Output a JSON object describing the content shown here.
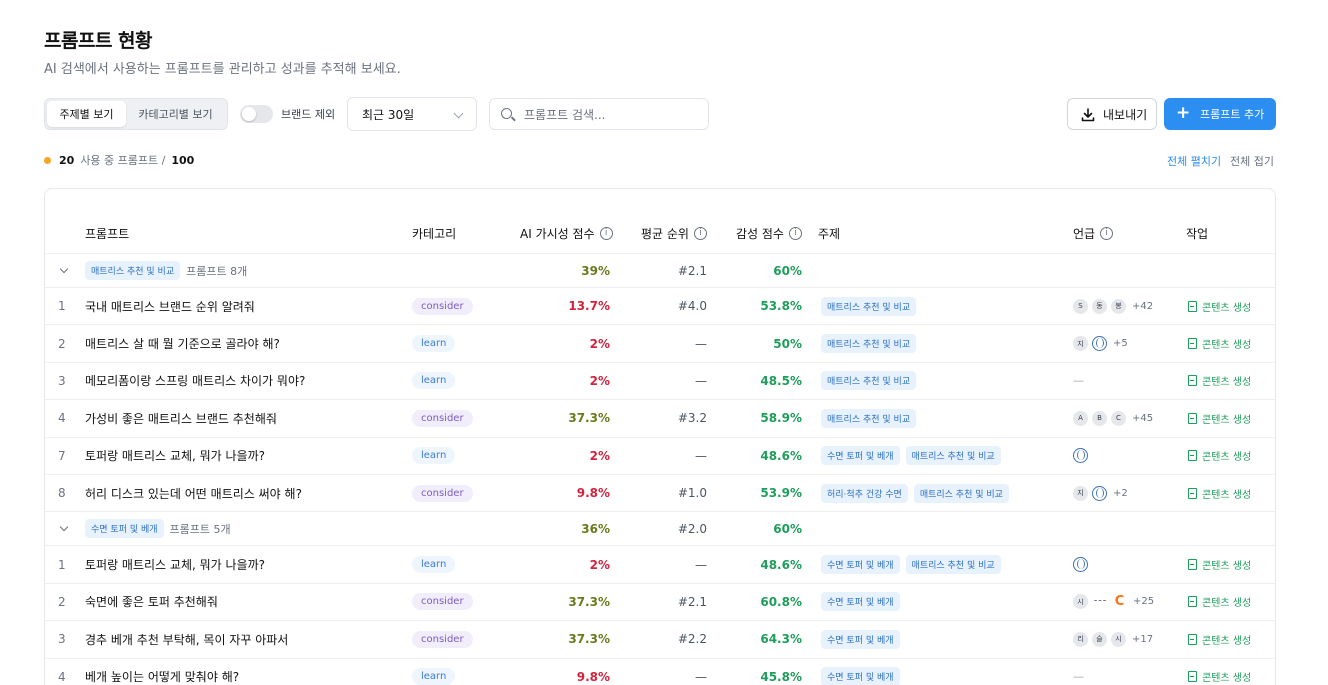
{
  "page": {
    "title": "프롬프트 현황",
    "subtitle": "AI 검색에서 사용하는 프롬프트를 관리하고 성과를 추적해 보세요."
  },
  "toolbar": {
    "view_topic": "주제별 보기",
    "view_category": "카테고리별 보기",
    "brand_toggle_label": "브랜드 제외",
    "period_value": "최근 30일",
    "search_placeholder": "프롬프트 검색...",
    "export_label": "내보내기",
    "add_label": "프롬프트 추가"
  },
  "usage": {
    "used": "20",
    "label": "사용 중 프롬프트 /",
    "total": "100",
    "expand_all": "전체 펼치기",
    "collapse_all": "전체 접기"
  },
  "colors": {
    "accent": "#2b8ef0",
    "score_red": "#d3243d",
    "score_olive": "#6b7a1f",
    "score_green": "#1f9d5b"
  },
  "table": {
    "headers": {
      "prompt": "프롬프트",
      "category": "카테고리",
      "visibility": "AI 가시성 점수",
      "rank": "평균 순위",
      "sentiment": "감성 점수",
      "topic": "주제",
      "mentions": "언급",
      "action": "작업"
    },
    "info_icon": "i",
    "action_label": "콘텐츠 생성",
    "groups": [
      {
        "tag": "매트리스 추천 및 비교",
        "count": "프롬프트 8개",
        "visibility": "39%",
        "rank": "#2.1",
        "sentiment": "60%",
        "visibility_color": "olive",
        "rows": [
          {
            "idx": "1",
            "prompt": "국내 매트리스 브랜드 순위 알려줘",
            "category": "consider",
            "visibility": "13.7%",
            "vcolor": "red",
            "rank": "#4.0",
            "sentiment": "53.8%",
            "topics": [
              "매트리스 추천 및 비교"
            ],
            "mentions": [
              {
                "t": "S"
              },
              {
                "t": "동"
              },
              {
                "t": "봉"
              }
            ],
            "more": "+42"
          },
          {
            "idx": "2",
            "prompt": "매트리스 살 때 뭘 기준으로 골라야 해?",
            "category": "learn",
            "visibility": "2%",
            "vcolor": "red",
            "rank": "—",
            "sentiment": "50%",
            "topics": [
              "매트리스 추천 및 비교"
            ],
            "mentions": [
              {
                "t": "지"
              },
              {
                "t": "globe"
              }
            ],
            "more": "+5"
          },
          {
            "idx": "3",
            "prompt": "메모리폼이랑 스프링 매트리스 차이가 뭐야?",
            "category": "learn",
            "visibility": "2%",
            "vcolor": "red",
            "rank": "—",
            "sentiment": "48.5%",
            "topics": [
              "매트리스 추천 및 비교"
            ],
            "mentions": [],
            "more": "—"
          },
          {
            "idx": "4",
            "prompt": "가성비 좋은 매트리스 브랜드 추천해줘",
            "category": "consider",
            "visibility": "37.3%",
            "vcolor": "olive",
            "rank": "#3.2",
            "sentiment": "58.9%",
            "topics": [
              "매트리스 추천 및 비교"
            ],
            "mentions": [
              {
                "t": "A"
              },
              {
                "t": "B"
              },
              {
                "t": "C"
              }
            ],
            "more": "+45"
          },
          {
            "idx": "7",
            "prompt": "토퍼랑 매트리스 교체, 뭐가 나을까?",
            "category": "learn",
            "visibility": "2%",
            "vcolor": "red",
            "rank": "—",
            "sentiment": "48.6%",
            "topics": [
              "수면 토퍼 및 베개",
              "매트리스 추천 및 비교"
            ],
            "mentions": [
              {
                "t": "globe"
              }
            ],
            "more": ""
          },
          {
            "idx": "8",
            "prompt": "허리 디스크 있는데 어떤 매트리스 써야 해?",
            "category": "consider",
            "visibility": "9.8%",
            "vcolor": "red",
            "rank": "#1.0",
            "sentiment": "53.9%",
            "topics": [
              "허리·척추 건강 수면",
              "매트리스 추천 및 비교"
            ],
            "mentions": [
              {
                "t": "지"
              },
              {
                "t": "globe"
              }
            ],
            "more": "+2"
          }
        ]
      },
      {
        "tag": "수면 토퍼 및 베개",
        "count": "프롬프트 5개",
        "visibility": "36%",
        "rank": "#2.0",
        "sentiment": "60%",
        "visibility_color": "olive",
        "rows": [
          {
            "idx": "1",
            "prompt": "토퍼랑 매트리스 교체, 뭐가 나을까?",
            "category": "learn",
            "visibility": "2%",
            "vcolor": "red",
            "rank": "—",
            "sentiment": "48.6%",
            "topics": [
              "수면 토퍼 및 베개",
              "매트리스 추천 및 비교"
            ],
            "mentions": [
              {
                "t": "globe"
              }
            ],
            "more": ""
          },
          {
            "idx": "2",
            "prompt": "숙면에 좋은 토퍼 추천해줘",
            "category": "consider",
            "visibility": "37.3%",
            "vcolor": "olive",
            "rank": "#2.1",
            "sentiment": "60.8%",
            "topics": [
              "수면 토퍼 및 베개"
            ],
            "mentions": [
              {
                "t": "시"
              },
              {
                "t": "dash"
              },
              {
                "t": "clogo"
              }
            ],
            "more": "+25"
          },
          {
            "idx": "3",
            "prompt": "경추 베개 추천 부탁해, 목이 자꾸 아파서",
            "category": "consider",
            "visibility": "37.3%",
            "vcolor": "olive",
            "rank": "#2.2",
            "sentiment": "64.3%",
            "topics": [
              "수면 토퍼 및 베개"
            ],
            "mentions": [
              {
                "t": "리"
              },
              {
                "t": "슬"
              },
              {
                "t": "시"
              }
            ],
            "more": "+17"
          },
          {
            "idx": "4",
            "prompt": "베개 높이는 어떻게 맞춰야 해?",
            "category": "learn",
            "visibility": "9.8%",
            "vcolor": "red",
            "rank": "—",
            "sentiment": "45.8%",
            "topics": [
              "수면 토퍼 및 베개"
            ],
            "mentions": [],
            "more": "—"
          }
        ]
      }
    ]
  }
}
